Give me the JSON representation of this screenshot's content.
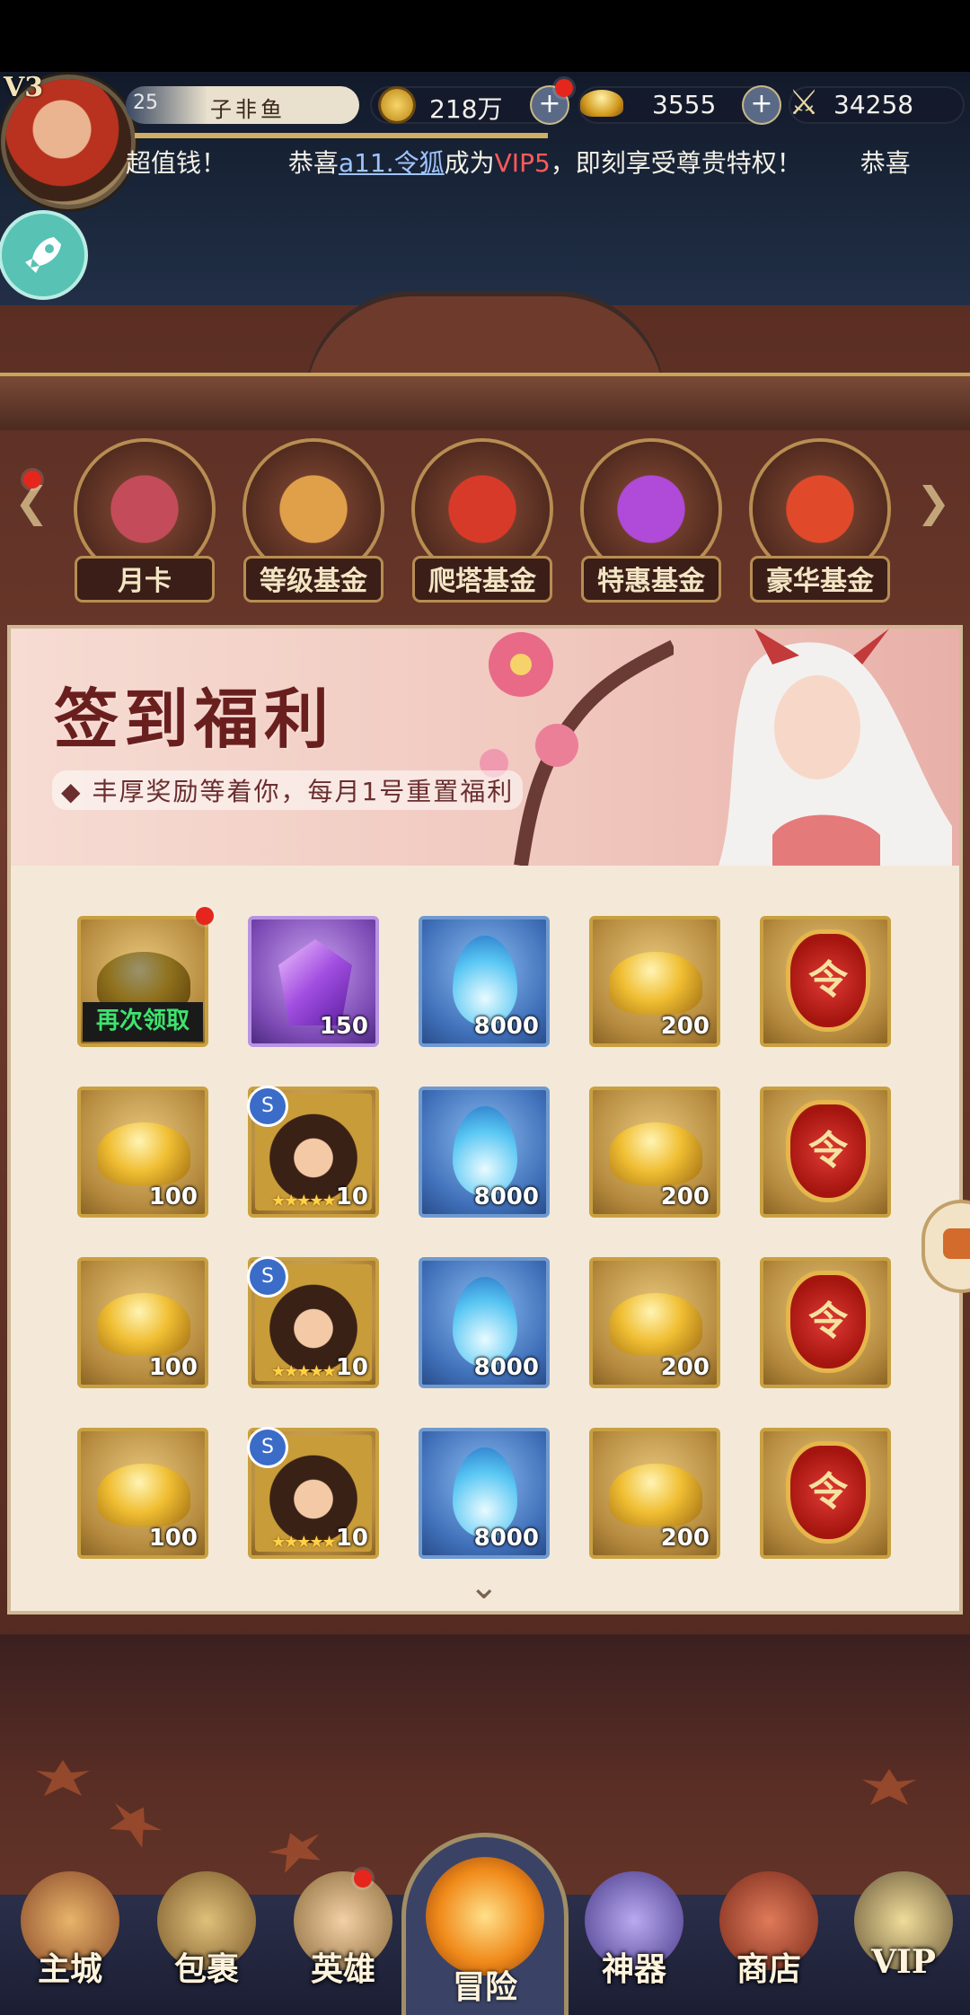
{
  "header": {
    "vip_level": "V3",
    "player_level": "25",
    "player_name": "子非鱼",
    "copper": "218万",
    "gold": "3555",
    "power": "34258",
    "ticker_prefix": "超值钱！",
    "ticker_congrats": "恭喜",
    "ticker_user": "a11.令狐",
    "ticker_became": "成为",
    "ticker_vip": "VIP5",
    "ticker_suffix": "，即刻享受尊贵特权！",
    "ticker_tail": "恭喜"
  },
  "tabs": [
    {
      "label": "月卡",
      "icon": "month-card-icon"
    },
    {
      "label": "等级基金",
      "icon": "treasure-chest-icon"
    },
    {
      "label": "爬塔基金",
      "icon": "pagoda-icon"
    },
    {
      "label": "特惠基金",
      "icon": "purple-bag-icon"
    },
    {
      "label": "豪华基金",
      "icon": "red-bag-icon"
    }
  ],
  "banner": {
    "title": "签到福利",
    "subtitle": "丰厚奖励等着你，每月1号重置福利"
  },
  "rewards": {
    "claim_again_label": "再次领取",
    "token_glyph": "令",
    "hero_badge": "S",
    "hero_stars": "★★★★★",
    "rows": [
      [
        {
          "type": "ingot",
          "qty": ""
        },
        {
          "type": "gem",
          "qty": "150"
        },
        {
          "type": "flame",
          "qty": "8000"
        },
        {
          "type": "ingot",
          "qty": "200"
        },
        {
          "type": "token",
          "qty": ""
        }
      ],
      [
        {
          "type": "ingot",
          "qty": "100"
        },
        {
          "type": "hero",
          "qty": "10"
        },
        {
          "type": "flame",
          "qty": "8000"
        },
        {
          "type": "ingot",
          "qty": "200"
        },
        {
          "type": "token",
          "qty": ""
        }
      ],
      [
        {
          "type": "ingot",
          "qty": "100"
        },
        {
          "type": "hero",
          "qty": "10"
        },
        {
          "type": "flame",
          "qty": "8000"
        },
        {
          "type": "ingot",
          "qty": "200"
        },
        {
          "type": "token",
          "qty": ""
        }
      ],
      [
        {
          "type": "ingot",
          "qty": "100"
        },
        {
          "type": "hero",
          "qty": "10"
        },
        {
          "type": "flame",
          "qty": "8000"
        },
        {
          "type": "ingot",
          "qty": "200"
        },
        {
          "type": "token",
          "qty": ""
        }
      ]
    ]
  },
  "bottom_nav": [
    {
      "label": "主城",
      "icon": "main-city-icon",
      "color": "#c7874a"
    },
    {
      "label": "包裹",
      "icon": "bag-icon",
      "color": "#b88a4a"
    },
    {
      "label": "英雄",
      "icon": "hero-icon",
      "color": "#c9a06c"
    },
    {
      "label": "冒险",
      "icon": "adventure-icon",
      "color": "#f08a1a"
    },
    {
      "label": "神器",
      "icon": "artifact-icon",
      "color": "#8a7ac8"
    },
    {
      "label": "商店",
      "icon": "shop-icon",
      "color": "#b84a3a"
    },
    {
      "label": "VIP",
      "icon": "vip-icon",
      "color": "#d8c07a"
    }
  ]
}
